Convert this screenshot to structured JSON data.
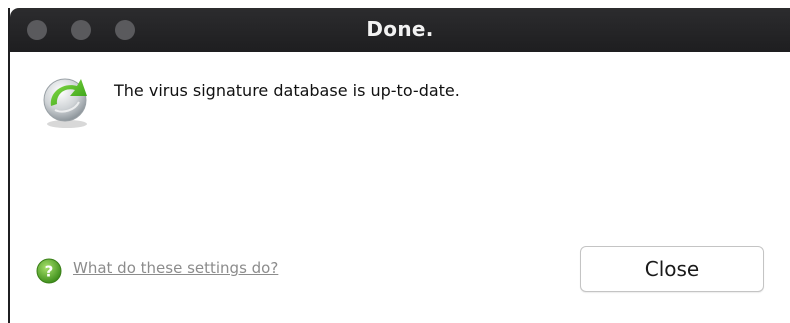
{
  "window": {
    "title": "Done."
  },
  "dialog": {
    "message": "The virus signature database is up-to-date.",
    "help_link": "What do these settings do?",
    "close_label": "Close",
    "status_icon": "update-complete-icon",
    "help_icon": "help-icon"
  },
  "colors": {
    "titlebar": "#1e1e20",
    "traffic_light": "#5a5a5d",
    "help_green": "#5fae2e",
    "update_green": "#4caf1f"
  }
}
